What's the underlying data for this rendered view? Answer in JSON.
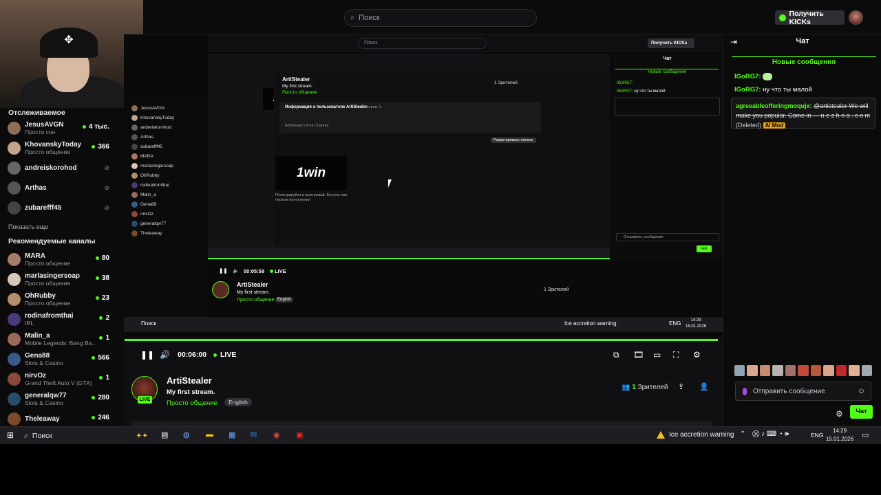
{
  "top": {
    "search_placeholder": "Поиск",
    "kicks_label": "Получить KICKs"
  },
  "sidebar": {
    "followed_heading": "Отслеживаемое",
    "followed": [
      {
        "name": "JesusAVGN",
        "cat": "Просто сон",
        "viewers": "4 тыс.",
        "live": true,
        "color": "#8d6e56"
      },
      {
        "name": "KhovanskyToday",
        "cat": "Просто общение",
        "viewers": "366",
        "live": true,
        "color": "#c3a58c"
      },
      {
        "name": "andreiskorohod",
        "cat": "",
        "viewers": "",
        "live": false,
        "color": "#666"
      },
      {
        "name": "Arthas",
        "cat": "",
        "viewers": "",
        "live": false,
        "color": "#555"
      },
      {
        "name": "zubarefff45",
        "cat": "",
        "viewers": "",
        "live": false,
        "color": "#444"
      }
    ],
    "show_more": "Показать еще",
    "recommended_heading": "Рекомендуемые каналы",
    "recommended": [
      {
        "name": "MARA",
        "cat": "Просто общение",
        "viewers": "80",
        "color": "#a77b6a"
      },
      {
        "name": "marlasingersoap",
        "cat": "Просто общение",
        "viewers": "38",
        "color": "#d9c6b8"
      },
      {
        "name": "OhRubby",
        "cat": "Просто общение",
        "viewers": "23",
        "color": "#b48e6a"
      },
      {
        "name": "rodinafromthai",
        "cat": "IRL",
        "viewers": "2",
        "color": "#4a3a7a"
      },
      {
        "name": "Malin_a",
        "cat": "Mobile Legends: Bang Ba...",
        "viewers": "1",
        "color": "#9a6a5a"
      },
      {
        "name": "Gena88",
        "cat": "Slots & Casino",
        "viewers": "566",
        "color": "#3a5a8a"
      },
      {
        "name": "nirvOz",
        "cat": "Grand Theft Auto V (GTA)",
        "viewers": "1",
        "color": "#8a4a3a"
      },
      {
        "name": "generalqw77",
        "cat": "Slots & Casino",
        "viewers": "280",
        "color": "#2a4a6a"
      },
      {
        "name": "Theleaway",
        "cat": "",
        "viewers": "246",
        "color": "#7a4a2a"
      }
    ]
  },
  "player": {
    "time": "00:06:00",
    "live": "LIVE",
    "progress": 1.0
  },
  "stream": {
    "streamer": "ArtiStealer",
    "title": "My first stream.",
    "category": "Просто общение",
    "language": "English",
    "viewers_count": "1",
    "viewers_label": "Зрителей",
    "live_badge": "LIVE"
  },
  "nested": {
    "search": "Поиск",
    "kicks": "Получить KICKs",
    "chat_title": "Чат",
    "new_msgs": "Новые сообщения",
    "ad": "1win",
    "streamer": "ArtiStealer",
    "title": "My first stream.",
    "category": "Просто общение",
    "lang": "English",
    "time": "00:05:58",
    "live": "LIVE",
    "viewers": "1 Зрителей",
    "panel_title": "Информация о пользователе ArtiStealer",
    "panel_followers": "Фолловеров: 1",
    "panel_desc": "ArtiStealer's Kick Channel",
    "edit_panels": "Редактировать панель",
    "ad_caption": "Регистрируйся и выигрывай. Бонусы при первом пополнении",
    "tb_search": "Поиск",
    "tb_warning": "Ice accretion warning",
    "tb_time": "14:29",
    "tb_date": "15.01.2026",
    "tb_lang": "ENG",
    "send_msg": "Отправить сообщение",
    "chat_btn": "Чат"
  },
  "chat": {
    "title": "Чат",
    "new_messages": "Новые сообщения",
    "messages": [
      {
        "user": "IGoRG7:",
        "text": ""
      },
      {
        "user": "IGoRG7:",
        "text": "ну что ты малой"
      }
    ],
    "deleted_msg": {
      "user": "agreeableofferingmoqujx:",
      "text": "@artistealer We will make you popular. Come in — n e z h n a . c o m",
      "deleted": "(Deleted)",
      "badge": "AI Mod"
    },
    "input_placeholder": "Отправить сообщение",
    "send_label": "Чат"
  },
  "taskbar": {
    "search": "Поиск",
    "warning": "Ice accretion warning",
    "lang": "ENG",
    "time": "14:29",
    "date": "15.01.2026"
  },
  "colors": {
    "accent": "#53fc18",
    "background": "#0b0b0c",
    "ai_mod": "#e5a21a"
  }
}
